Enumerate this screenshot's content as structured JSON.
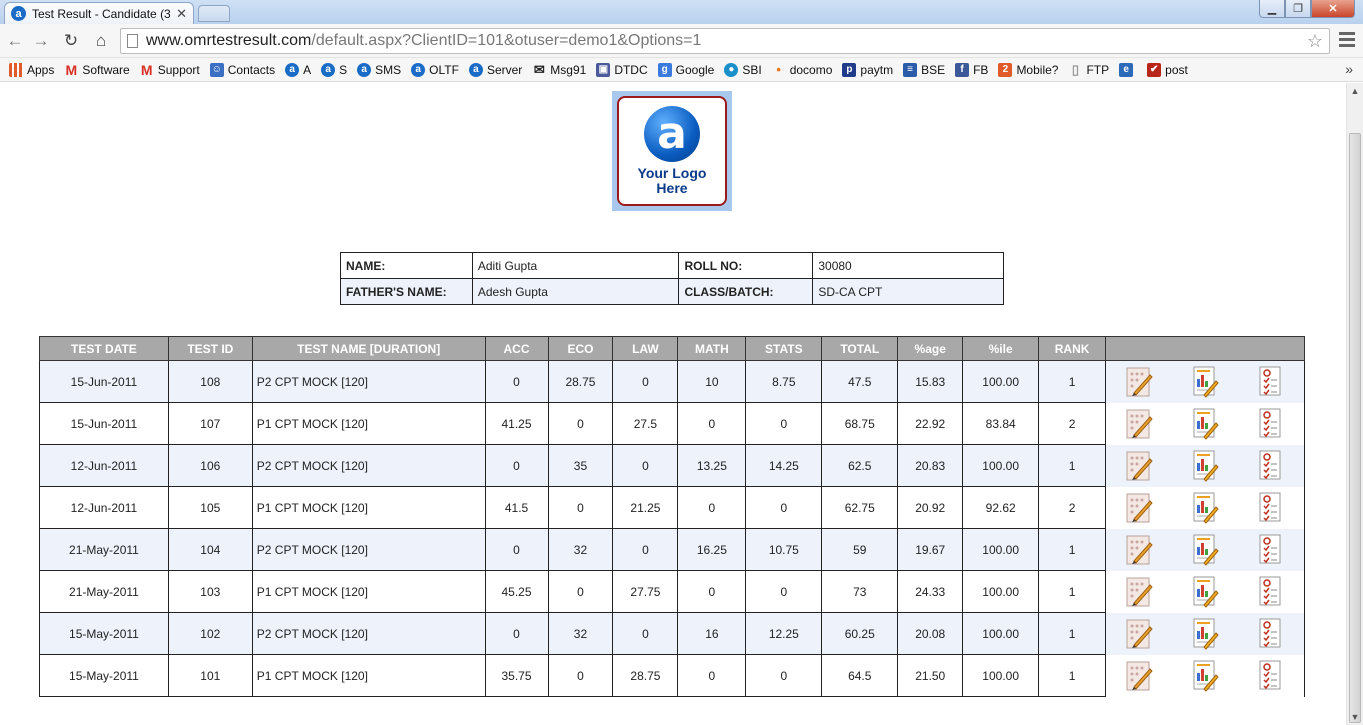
{
  "browser": {
    "tab_title": "Test Result - Candidate (3",
    "tab_favicon": "a",
    "url_host": "www.omrtestresult.com",
    "url_rest": "/default.aspx?ClientID=101&otuser=demo1&Options=1",
    "bookmarks": [
      {
        "label": "Apps",
        "icon": "apps-grid-icon",
        "color": "#e05a2a",
        "glyph": ""
      },
      {
        "label": "Software",
        "icon": "gmail-icon",
        "color": "#d93025",
        "glyph": "M"
      },
      {
        "label": "Support",
        "icon": "gmail-icon",
        "color": "#d93025",
        "glyph": "M"
      },
      {
        "label": "Contacts",
        "icon": "contacts-icon",
        "color": "#3b6fc4",
        "glyph": "☺"
      },
      {
        "label": "A",
        "icon": "a-logo-icon",
        "color": "#1a6cc7",
        "glyph": "a"
      },
      {
        "label": "S",
        "icon": "a-logo-icon",
        "color": "#1a6cc7",
        "glyph": "a"
      },
      {
        "label": "SMS",
        "icon": "a-logo-icon",
        "color": "#1a6cc7",
        "glyph": "a"
      },
      {
        "label": "OLTF",
        "icon": "a-logo-icon",
        "color": "#1a6cc7",
        "glyph": "a"
      },
      {
        "label": "Server",
        "icon": "a-logo-icon",
        "color": "#1a6cc7",
        "glyph": "a"
      },
      {
        "label": "Msg91",
        "icon": "envelope-icon",
        "color": "#222222",
        "glyph": "✉"
      },
      {
        "label": "DTDC",
        "icon": "monitor-icon",
        "color": "#4a5a9a",
        "glyph": "▣"
      },
      {
        "label": "Google",
        "icon": "google-icon",
        "color": "#3b7be0",
        "glyph": "g"
      },
      {
        "label": "SBI",
        "icon": "sbi-icon",
        "color": "#1a8fc9",
        "glyph": "●"
      },
      {
        "label": "docomo",
        "icon": "docomo-icon",
        "color": "#f07820",
        "glyph": "•"
      },
      {
        "label": "paytm",
        "icon": "paytm-icon",
        "color": "#1f3b8a",
        "glyph": "p"
      },
      {
        "label": "BSE",
        "icon": "bse-icon",
        "color": "#2a5aa8",
        "glyph": "≡"
      },
      {
        "label": "FB",
        "icon": "facebook-icon",
        "color": "#3b5998",
        "glyph": "f"
      },
      {
        "label": "Mobile?",
        "icon": "number-two-icon",
        "color": "#e05a2a",
        "glyph": "2"
      },
      {
        "label": "FTP",
        "icon": "page-icon",
        "color": "#9a9a9a",
        "glyph": "▯"
      },
      {
        "label": "",
        "icon": "ie-icon",
        "color": "#2a6ab8",
        "glyph": "e"
      },
      {
        "label": "post",
        "icon": "checkmark-icon",
        "color": "#b8261a",
        "glyph": "✔"
      }
    ],
    "bookmarks_more": "»"
  },
  "logo": {
    "glyph": "a",
    "line1": "Your Logo",
    "line2": "Here"
  },
  "candidate": {
    "name_label": "NAME:",
    "name": "Aditi Gupta",
    "roll_label": "ROLL NO:",
    "roll": "30080",
    "father_label": "FATHER'S NAME:",
    "father": "Adesh Gupta",
    "class_label": "CLASS/BATCH:",
    "class": "SD-CA CPT"
  },
  "results": {
    "headers": [
      "TEST DATE",
      "TEST ID",
      "TEST NAME [DURATION]",
      "ACC",
      "ECO",
      "LAW",
      "MATH",
      "STATS",
      "TOTAL",
      "%age",
      "%ile",
      "RANK",
      ""
    ],
    "rows": [
      [
        "15-Jun-2011",
        "108",
        "P2 CPT MOCK [120]",
        "0",
        "28.75",
        "0",
        "10",
        "8.75",
        "47.5",
        "15.83",
        "100.00",
        "1"
      ],
      [
        "15-Jun-2011",
        "107",
        "P1 CPT MOCK [120]",
        "41.25",
        "0",
        "27.5",
        "0",
        "0",
        "68.75",
        "22.92",
        "83.84",
        "2"
      ],
      [
        "12-Jun-2011",
        "106",
        "P2 CPT MOCK [120]",
        "0",
        "35",
        "0",
        "13.25",
        "14.25",
        "62.5",
        "20.83",
        "100.00",
        "1"
      ],
      [
        "12-Jun-2011",
        "105",
        "P1 CPT MOCK [120]",
        "41.5",
        "0",
        "21.25",
        "0",
        "0",
        "62.75",
        "20.92",
        "92.62",
        "2"
      ],
      [
        "21-May-2011",
        "104",
        "P2 CPT MOCK [120]",
        "0",
        "32",
        "0",
        "16.25",
        "10.75",
        "59",
        "19.67",
        "100.00",
        "1"
      ],
      [
        "21-May-2011",
        "103",
        "P1 CPT MOCK [120]",
        "45.25",
        "0",
        "27.75",
        "0",
        "0",
        "73",
        "24.33",
        "100.00",
        "1"
      ],
      [
        "15-May-2011",
        "102",
        "P2 CPT MOCK [120]",
        "0",
        "32",
        "0",
        "16",
        "12.25",
        "60.25",
        "20.08",
        "100.00",
        "1"
      ],
      [
        "15-May-2011",
        "101",
        "P1 CPT MOCK [120]",
        "35.75",
        "0",
        "28.75",
        "0",
        "0",
        "64.5",
        "21.50",
        "100.00",
        "1"
      ]
    ],
    "row_icons": [
      "omr-sheet-icon",
      "analysis-report-icon",
      "answer-key-icon"
    ]
  }
}
